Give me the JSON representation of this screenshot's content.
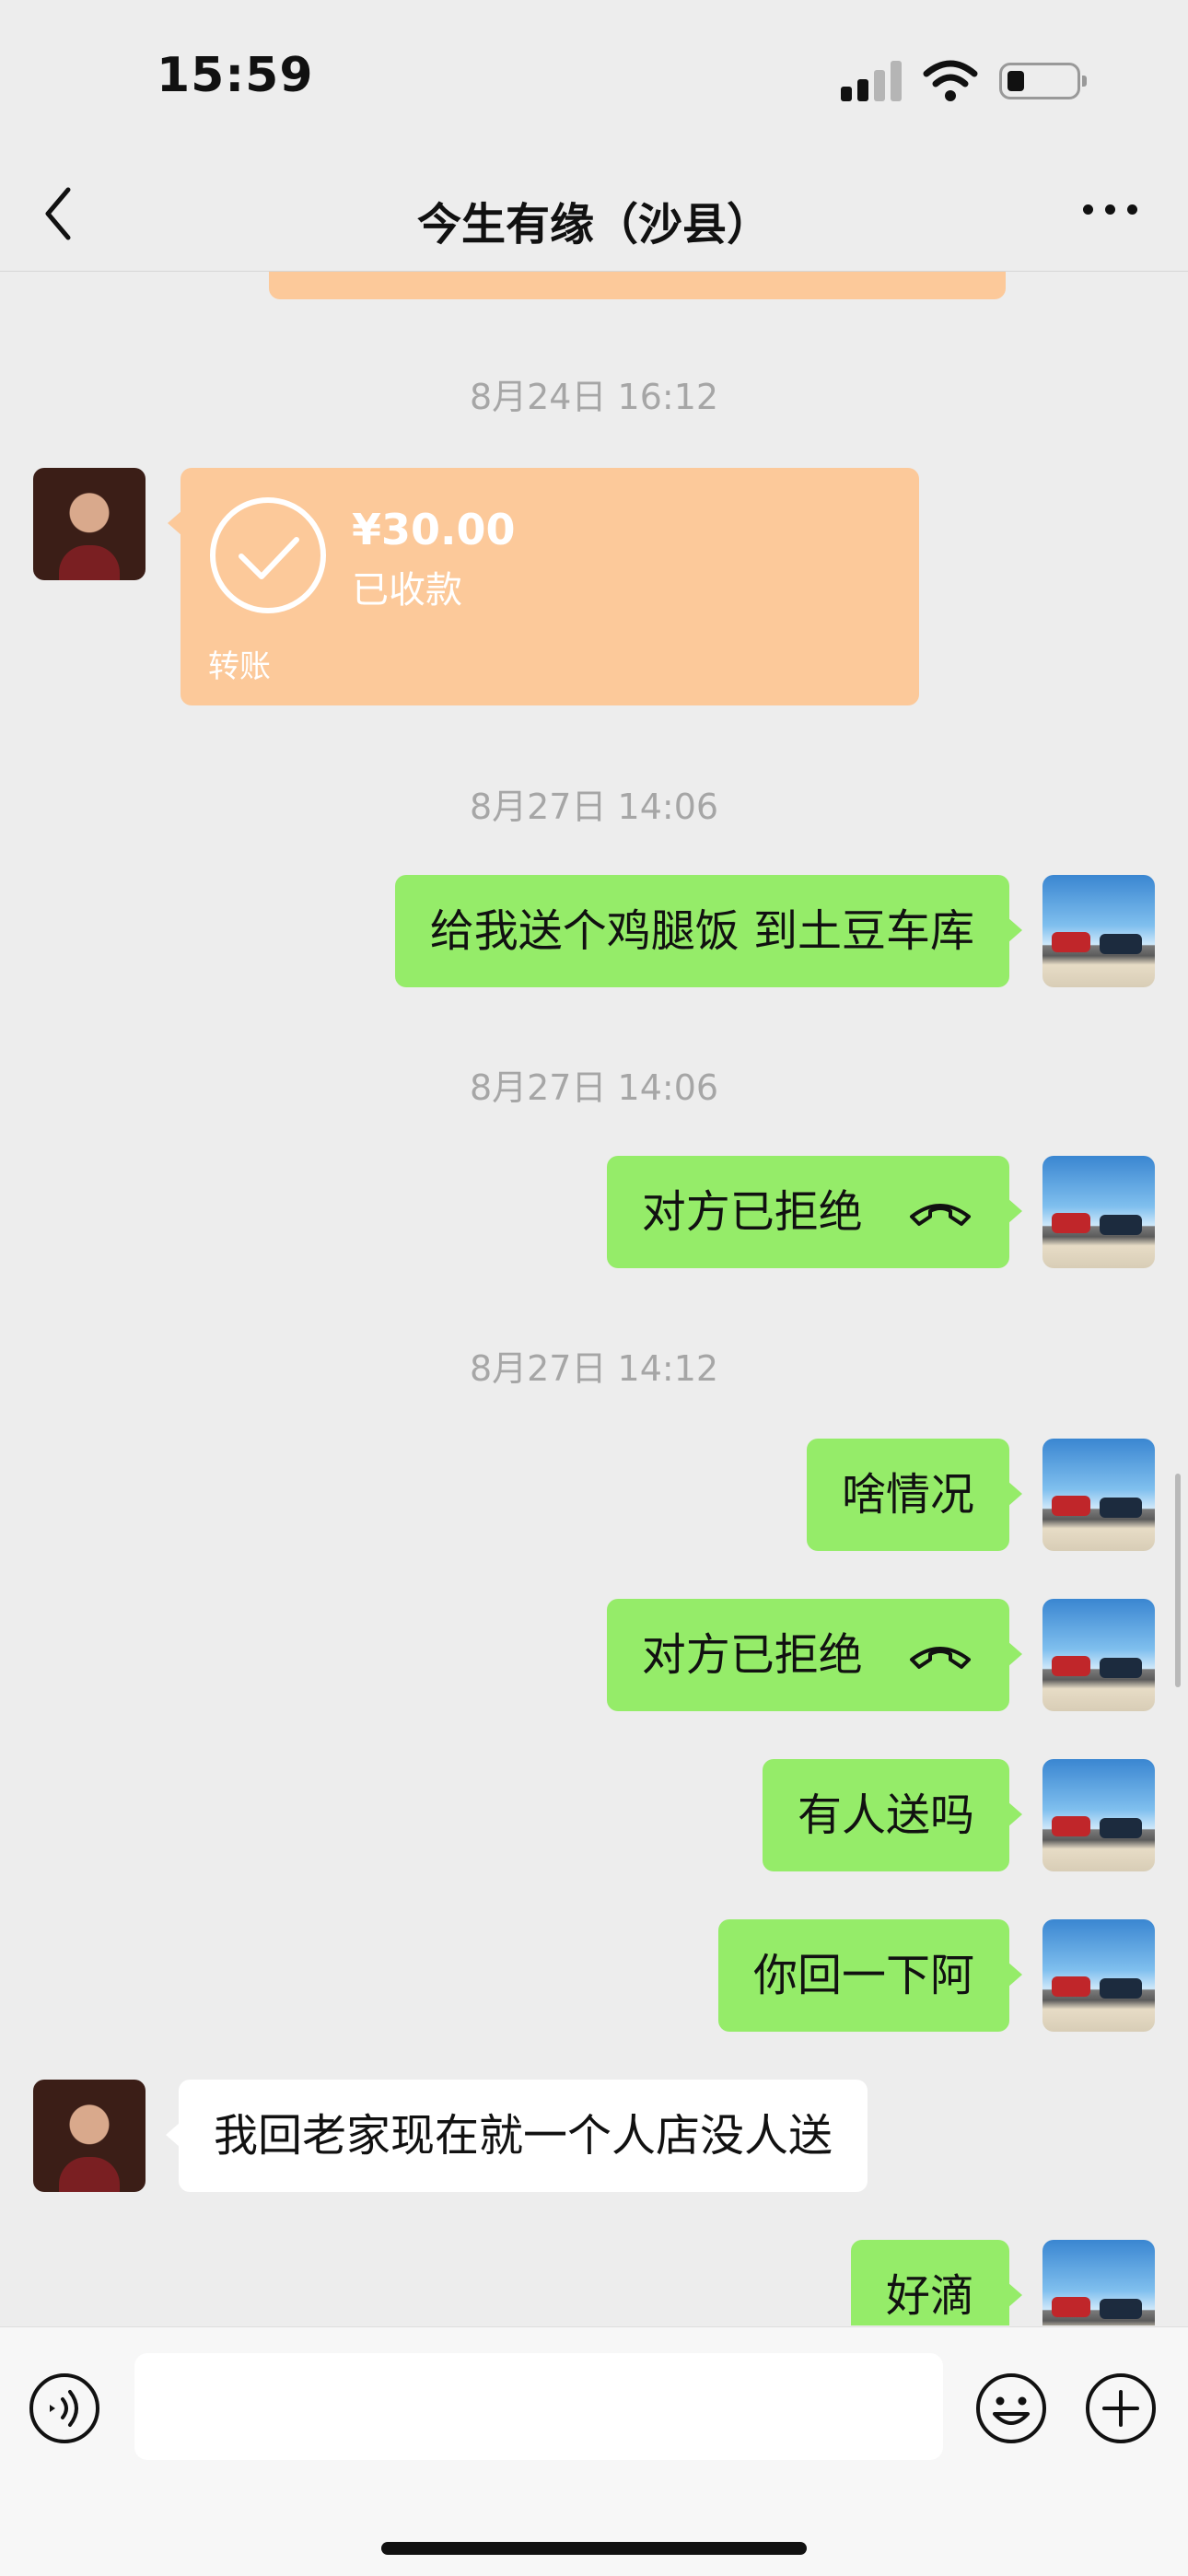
{
  "status_bar": {
    "time": "15:59"
  },
  "nav": {
    "title": "今生有缘（沙县）"
  },
  "messages": {
    "ts1": "8月24日 16:12",
    "transfer": {
      "amount": "¥30.00",
      "status": "已收款",
      "label": "转账"
    },
    "ts2": "8月27日 14:06",
    "m1": "给我送个鸡腿饭 到土豆车库",
    "ts3": "8月27日 14:06",
    "m2": "对方已拒绝",
    "ts4": "8月27日 14:12",
    "m3": "啥情况",
    "m4": "对方已拒绝",
    "m5": "有人送吗",
    "m6": "你回一下阿",
    "m7": "我回老家现在就一个人店没人送",
    "m8": "好滴"
  },
  "input": {
    "value": ""
  },
  "colors": {
    "my_bubble": "#95ec69",
    "their_bubble": "#ffffff",
    "transfer_card": "#fcc99a",
    "background": "#ededed"
  },
  "icons": [
    "back-icon",
    "more-icon",
    "check-icon",
    "hangup-icon",
    "voice-icon",
    "emoji-icon",
    "plus-icon"
  ]
}
